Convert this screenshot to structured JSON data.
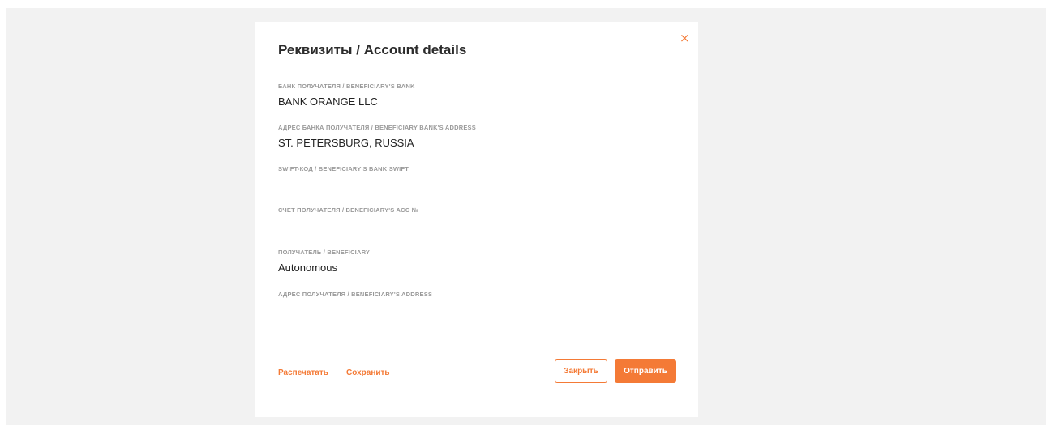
{
  "modal": {
    "title": "Реквизиты / Account details",
    "close_icon": "×"
  },
  "fields": [
    {
      "label": "БАНК ПОЛУЧАТЕЛЯ / BENEFICIARY'S BANK",
      "value": "BANK ORANGE LLC"
    },
    {
      "label": "АДРЕС БАНКА ПОЛУЧАТЕЛЯ / BENEFICIARY BANK'S ADDRESS",
      "value": "ST. PETERSBURG, RUSSIA"
    },
    {
      "label": "SWIFT-КОД / BENEFICIARY'S BANK SWIFT",
      "value": ""
    },
    {
      "label": "СЧЕТ ПОЛУЧАТЕЛЯ / BENEFICIARY'S ACC №",
      "value": ""
    },
    {
      "label": "ПОЛУЧАТЕЛЬ / BENEFICIARY",
      "value": "Autonomous"
    },
    {
      "label": "АДРЕС ПОЛУЧАТЕЛЯ / BENEFICIARY'S ADDRESS",
      "value": ""
    }
  ],
  "footer": {
    "print_label": "Распечатать",
    "save_label": "Сохранить",
    "close_label": "Закрыть",
    "send_label": "Отправить"
  },
  "colors": {
    "accent": "#f47a36",
    "backdrop": "#f2f2f2"
  }
}
